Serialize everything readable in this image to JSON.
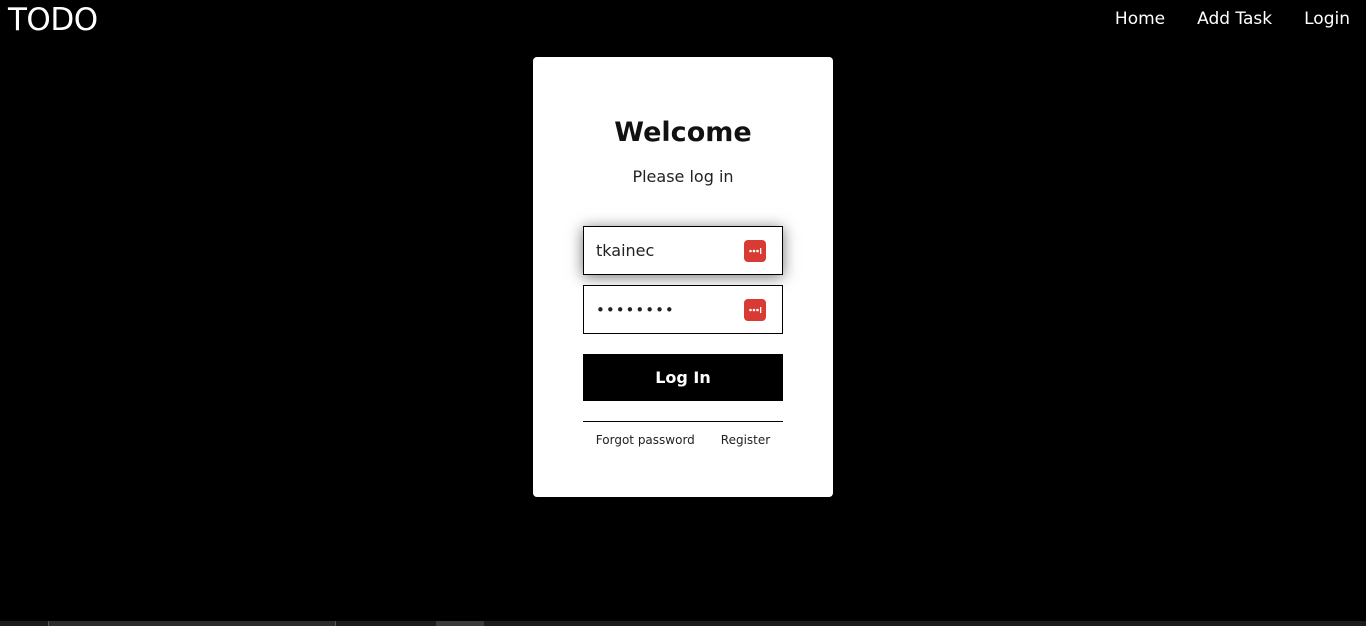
{
  "navbar": {
    "brand": "TODO",
    "links": [
      {
        "label": "Home"
      },
      {
        "label": "Add Task"
      },
      {
        "label": "Login"
      }
    ]
  },
  "login_card": {
    "title": "Welcome",
    "subtitle": "Please log in",
    "username": {
      "value": "tkainec",
      "icon": "password-manager-icon"
    },
    "password": {
      "value": "password",
      "icon": "password-manager-icon"
    },
    "submit_label": "Log In",
    "forgot_password_label": "Forgot password",
    "register_label": "Register"
  },
  "colors": {
    "page_background": "#000000",
    "card_background": "#ffffff",
    "button_background": "#000000",
    "password_manager_icon": "#d83a34"
  }
}
